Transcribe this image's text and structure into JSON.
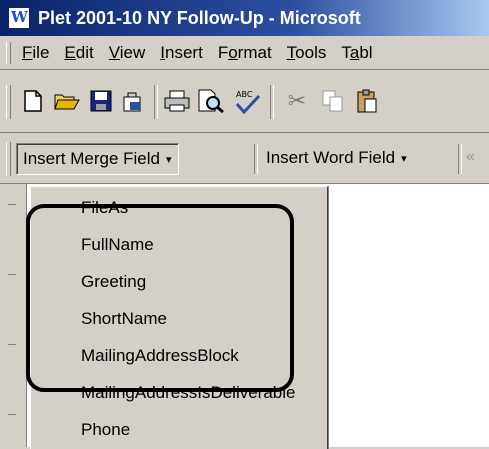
{
  "window": {
    "title": "Plet 2001-10 NY Follow-Up - Microsoft",
    "app_icon": "word-icon"
  },
  "menubar": {
    "items": [
      {
        "label": "File",
        "accel": "F"
      },
      {
        "label": "Edit",
        "accel": "E"
      },
      {
        "label": "View",
        "accel": "V"
      },
      {
        "label": "Insert",
        "accel": "I"
      },
      {
        "label": "Format",
        "accel": "o"
      },
      {
        "label": "Tools",
        "accel": "T"
      },
      {
        "label": "Tabl",
        "accel": "a"
      }
    ]
  },
  "toolbar": {
    "icons": [
      "new-document-icon",
      "open-folder-icon",
      "save-icon",
      "permission-icon",
      "print-icon",
      "print-preview-icon",
      "spelling-icon",
      "cut-icon",
      "copy-icon",
      "paste-icon"
    ]
  },
  "mergebar": {
    "insert_merge_field": "Insert Merge Field",
    "insert_word_field": "Insert Word Field",
    "arrow": "▾"
  },
  "dropdown": {
    "items": [
      "FileAs",
      "FullName",
      "Greeting",
      "ShortName",
      "MailingAddressBlock",
      "MailingAddressIsDeliverable",
      "Phone"
    ]
  }
}
